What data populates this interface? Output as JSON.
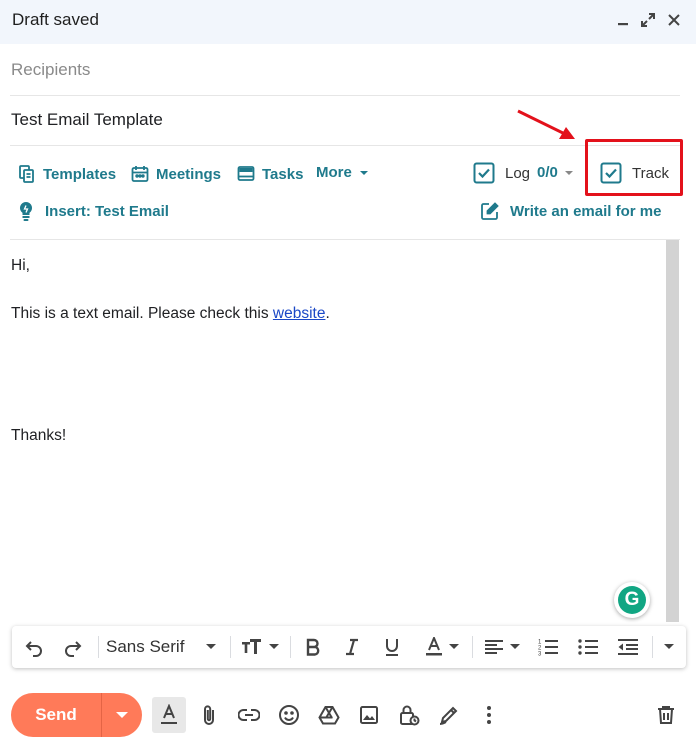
{
  "window": {
    "title": "Draft saved"
  },
  "compose": {
    "recipients_placeholder": "Recipients",
    "subject": "Test Email Template"
  },
  "tools": {
    "templates": "Templates",
    "meetings": "Meetings",
    "tasks": "Tasks",
    "more": "More",
    "log_label": "Log",
    "log_count": "0/0",
    "track_label": "Track",
    "insert_label": "Insert: Test Email",
    "write_label": "Write an email for me",
    "log_checked": true,
    "track_checked": true
  },
  "body": {
    "greeting": "Hi,",
    "line_prefix": "This is a text email. Please check this ",
    "link_text": "website",
    "line_suffix": ".",
    "closing": "Thanks!"
  },
  "format": {
    "font_name": "Sans Serif"
  },
  "actions": {
    "send_label": "Send"
  },
  "colors": {
    "accent_teal": "#1f7a8c",
    "send_orange": "#ff7a59",
    "highlight_red": "#e3111b",
    "link_blue": "#1a47c6",
    "grammarly_green": "#11a683"
  }
}
